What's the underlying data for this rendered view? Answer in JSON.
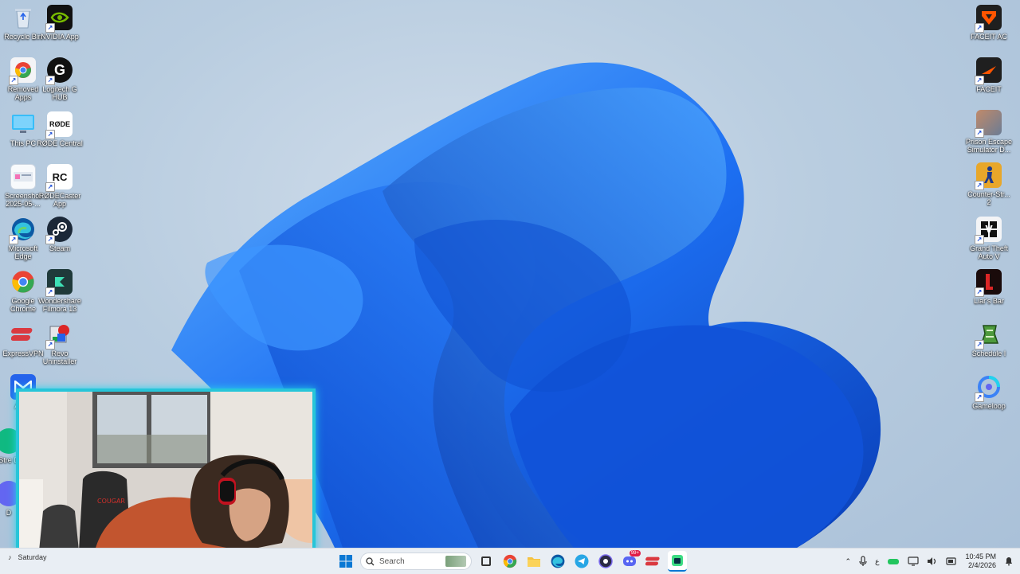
{
  "desktop": {
    "left_icons": [
      {
        "label": "Recycle Bin",
        "icon": "recycle-bin-icon"
      },
      {
        "label": "NVIDIA App",
        "icon": "nvidia-icon"
      },
      {
        "label": "Removed Apps",
        "icon": "chrome-icon"
      },
      {
        "label": "Logitech G HUB",
        "icon": "logitech-icon"
      },
      {
        "label": "This PC",
        "icon": "monitor-icon"
      },
      {
        "label": "RØDE Central",
        "icon": "rode-icon"
      },
      {
        "label": "Screenshot 2025-05-...",
        "icon": "screenshot-icon"
      },
      {
        "label": "RØDECaster App",
        "icon": "rodecaster-icon"
      },
      {
        "label": "Microsoft Edge",
        "icon": "edge-icon"
      },
      {
        "label": "Steam",
        "icon": "steam-icon"
      },
      {
        "label": "Google Chrome",
        "icon": "chrome-icon"
      },
      {
        "label": "Wondershare Filmora 13",
        "icon": "filmora-icon"
      },
      {
        "label": "ExpressVPN",
        "icon": "expressvpn-icon"
      },
      {
        "label": "Revo Uninstaller",
        "icon": "revo-icon"
      }
    ],
    "right_icons": [
      {
        "label": "FACEIT AC",
        "icon": "faceit-ac-icon"
      },
      {
        "label": "FACEIT",
        "icon": "faceit-icon"
      },
      {
        "label": "Prison Escape Simulator D...",
        "icon": "prison-escape-icon"
      },
      {
        "label": "Counter-Str... 2",
        "icon": "counter-strike-icon"
      },
      {
        "label": "Grand Theft Auto V",
        "icon": "gta-icon"
      },
      {
        "label": "Liar's Bar",
        "icon": "liars-bar-icon"
      },
      {
        "label": "Schedule I",
        "icon": "schedule-icon"
      },
      {
        "label": "Gameloop",
        "icon": "gameloop-icon"
      }
    ],
    "partial_labels": [
      "Ad Bi",
      "Stre D",
      "D"
    ]
  },
  "taskbar": {
    "weather_text": "Saturday",
    "search_placeholder": "Search",
    "apps": [
      {
        "name": "file-explorer-icon"
      },
      {
        "name": "chrome-icon"
      },
      {
        "name": "folder-icon"
      },
      {
        "name": "edge-icon"
      },
      {
        "name": "telegram-icon"
      },
      {
        "name": "obs-icon"
      },
      {
        "name": "discord-icon",
        "badge": "99+"
      },
      {
        "name": "expressvpn-icon"
      },
      {
        "name": "android-studio-icon"
      }
    ],
    "tray": {
      "language": "ع",
      "time": "10:45 PM",
      "date": "2/4/2026"
    }
  },
  "colors": {
    "taskbar_bg": "#e9eef4",
    "webcam_border": "#27c5d8",
    "wallpaper_blue": "#1565e8"
  }
}
